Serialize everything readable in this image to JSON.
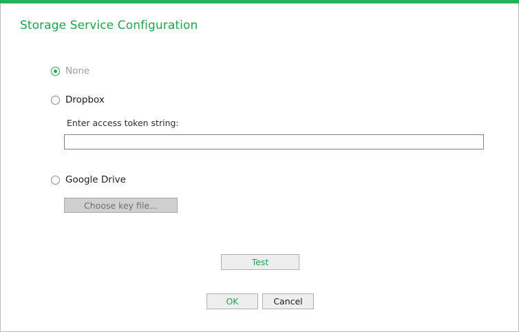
{
  "dialog": {
    "title": "Storage Service Configuration",
    "accent_color": "#27b05b"
  },
  "options": {
    "none": {
      "label": "None",
      "selected": true,
      "disabled": true
    },
    "dropbox": {
      "label": "Dropbox",
      "selected": false,
      "token_label": "Enter access token string:",
      "token_value": ""
    },
    "google_drive": {
      "label": "Google Drive",
      "selected": false,
      "choose_key_label": "Choose key file..."
    }
  },
  "buttons": {
    "test_label": "Test",
    "ok_label": "OK",
    "cancel_label": "Cancel"
  }
}
